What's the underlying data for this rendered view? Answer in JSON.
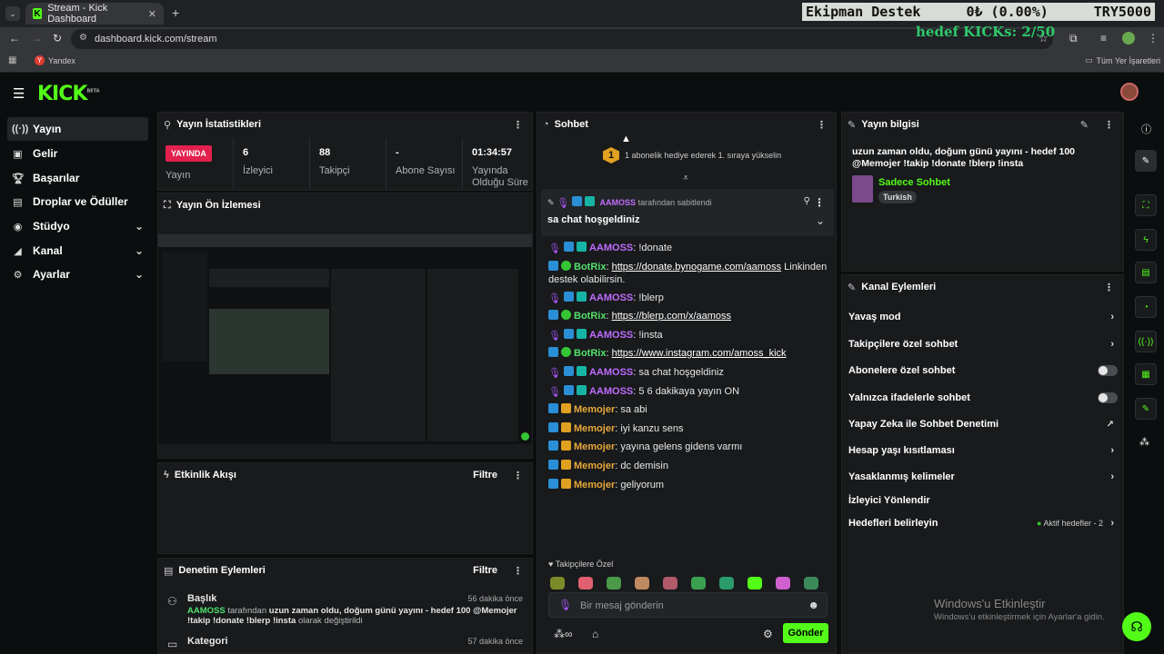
{
  "browser": {
    "tab_title": "Stream - Kick Dashboard",
    "url": "dashboard.kick.com/stream",
    "bookmark_yandex": "Yandex",
    "bookmark_all": "Tüm Yer İşaretleri"
  },
  "overlay": {
    "ticker_name": "Ekipman Destek",
    "ticker_amount": "0₺ (0.00%)",
    "ticker_target": "TRY5000",
    "kick_goal": "hedef KICKs: 2/50"
  },
  "app": {
    "logo": "KICK",
    "logo_tag": "BETA"
  },
  "sidebar": {
    "items": [
      {
        "label": "Yayın",
        "icon": "broadcast-icon"
      },
      {
        "label": "Gelir",
        "icon": "revenue-icon"
      },
      {
        "label": "Başarılar",
        "icon": "trophy-icon"
      },
      {
        "label": "Droplar ve Ödüller",
        "icon": "gift-icon"
      },
      {
        "label": "Stüdyo",
        "icon": "studio-icon"
      },
      {
        "label": "Kanal",
        "icon": "megaphone-icon"
      },
      {
        "label": "Ayarlar",
        "icon": "gear-icon"
      }
    ]
  },
  "stats": {
    "title": "Yayın İstatistikleri",
    "live_badge": "YAYINDA",
    "live_label": "Yayın",
    "viewers_value": "6",
    "viewers_label": "İzleyici",
    "followers_value": "88",
    "followers_label": "Takipçi",
    "subs_value": "-",
    "subs_label": "Abone Sayısı",
    "uptime_value": "01:34:57",
    "uptime_label": "Yayında Olduğu Süre"
  },
  "preview": {
    "title": "Yayın Ön İzlemesi"
  },
  "activity": {
    "title": "Etkinlik Akışı",
    "filter": "Filtre"
  },
  "moderation": {
    "title": "Denetim Eylemleri",
    "filter": "Filtre",
    "entry1_type": "Başlık",
    "entry1_time": "56 dakika önce",
    "entry1_user": "AAMOSS",
    "entry1_mid": "tarafından",
    "entry1_text": "uzun zaman oldu, doğum günü yayını - hedef 100 @Memojer !takip !donate !blerp !insta",
    "entry1_tail": "olarak değiştirildi",
    "entry2_type": "Kategori",
    "entry2_time": "57 dakika önce"
  },
  "chat": {
    "title": "Sohbet",
    "sub_goal_num": "1",
    "sub_goal_text": "1 abonelik hediye ederek 1. sıraya yükselin",
    "pinned_by_user": "AAMOSS",
    "pinned_by_text": "tarafından sabitlendi",
    "pinned_message": "sa chat hoşgeldiniz",
    "messages": [
      {
        "user": "AAMOSS",
        "text": "!donate"
      },
      {
        "user": "BotRix",
        "link": "https://donate.bynogame.com/aamoss",
        "text": "Linkinden destek olabilirsin."
      },
      {
        "user": "AAMOSS",
        "text": "!blerp"
      },
      {
        "user": "BotRix",
        "link": "https://blerp.com/x/aamoss",
        "text": ""
      },
      {
        "user": "AAMOSS",
        "text": "!insta"
      },
      {
        "user": "BotRix",
        "link": "https://www.instagram.com/amoss_kick",
        "text": ""
      },
      {
        "user": "AAMOSS",
        "text": "sa chat hoşgeldiniz"
      },
      {
        "user": "AAMOSS",
        "text": "5 6 dakikaya yayın ON"
      },
      {
        "user": "Memojer",
        "text": "sa abi"
      },
      {
        "user": "Memojer",
        "text": "iyi kanzu sens"
      },
      {
        "user": "Memojer",
        "text": "yayına gelens gidens varmı"
      },
      {
        "user": "Memojer",
        "text": "dc demisin"
      },
      {
        "user": "Memojer",
        "text": "geliyorum"
      }
    ],
    "followers_only": "Takipçilere Özel",
    "input_placeholder": "Bir mesaj gönderin",
    "send_label": "Gönder"
  },
  "stream_info": {
    "title": "Yayın bilgisi",
    "stream_title": "uzun zaman oldu, doğum günü yayını - hedef 100 @Memojer !takip !donate !blerp !insta",
    "category": "Sadece Sohbet",
    "language": "Turkish"
  },
  "channel_actions": {
    "title": "Kanal Eylemleri",
    "slow_mode": "Yavaş mod",
    "followers_chat": "Takipçilere özel sohbet",
    "subs_chat": "Abonelere özel sohbet",
    "emote_chat": "Yalnızca ifadelerle sohbet",
    "ai_mod": "Yapay Zeka ile Sohbet Denetimi",
    "age_limit": "Hesap yaşı kısıtlaması",
    "banned_words": "Yasaklanmış kelimeler",
    "redirect": "İzleyici Yönlendir",
    "goals": "Hedefleri belirleyin",
    "goals_status": "Aktif hedefler - 2"
  },
  "windows": {
    "activate_title": "Windows'u Etkinleştir",
    "activate_sub": "Windows'u etkinleştirmek için Ayarlar'a gidin."
  },
  "colors": {
    "accent": "#53fc18",
    "live": "#e2214d",
    "panel": "#181a1c"
  }
}
